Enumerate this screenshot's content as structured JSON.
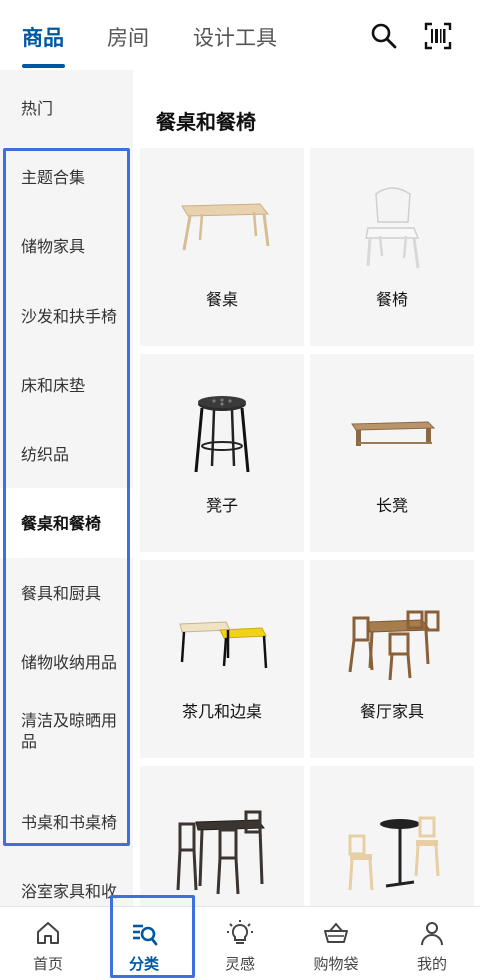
{
  "top_tabs": [
    {
      "label": "商品"
    },
    {
      "label": "房间"
    },
    {
      "label": "设计工具"
    }
  ],
  "top_icons": {
    "search": "search-icon",
    "barcode": "barcode-scan-icon"
  },
  "sidebar": {
    "items": [
      {
        "label": "热门"
      },
      {
        "label": "主题合集"
      },
      {
        "label": "储物家具"
      },
      {
        "label": "沙发和扶手椅"
      },
      {
        "label": "床和床垫"
      },
      {
        "label": "纺织品"
      },
      {
        "label": "餐桌和餐椅"
      },
      {
        "label": "餐具和厨具"
      },
      {
        "label": "储物收纳用品"
      },
      {
        "label": "清洁及晾晒用品"
      },
      {
        "label": "书桌和书桌椅"
      },
      {
        "label": "浴室家具和收"
      }
    ],
    "selected": "餐桌和餐椅"
  },
  "main": {
    "title": "餐桌和餐椅",
    "products": [
      {
        "label": "餐桌"
      },
      {
        "label": "餐椅"
      },
      {
        "label": "凳子"
      },
      {
        "label": "长凳"
      },
      {
        "label": "茶几和边桌"
      },
      {
        "label": "餐厅家具"
      },
      {
        "label": ""
      },
      {
        "label": ""
      }
    ]
  },
  "bottom_nav": [
    {
      "label": "首页",
      "icon": "home-icon"
    },
    {
      "label": "分类",
      "icon": "category-search-icon"
    },
    {
      "label": "灵感",
      "icon": "lightbulb-icon"
    },
    {
      "label": "购物袋",
      "icon": "basket-icon"
    },
    {
      "label": "我的",
      "icon": "user-icon"
    }
  ],
  "colors": {
    "accent": "#0058a3",
    "highlight": "#3e6fe0",
    "sidebar_bg": "#f5f5f5"
  }
}
